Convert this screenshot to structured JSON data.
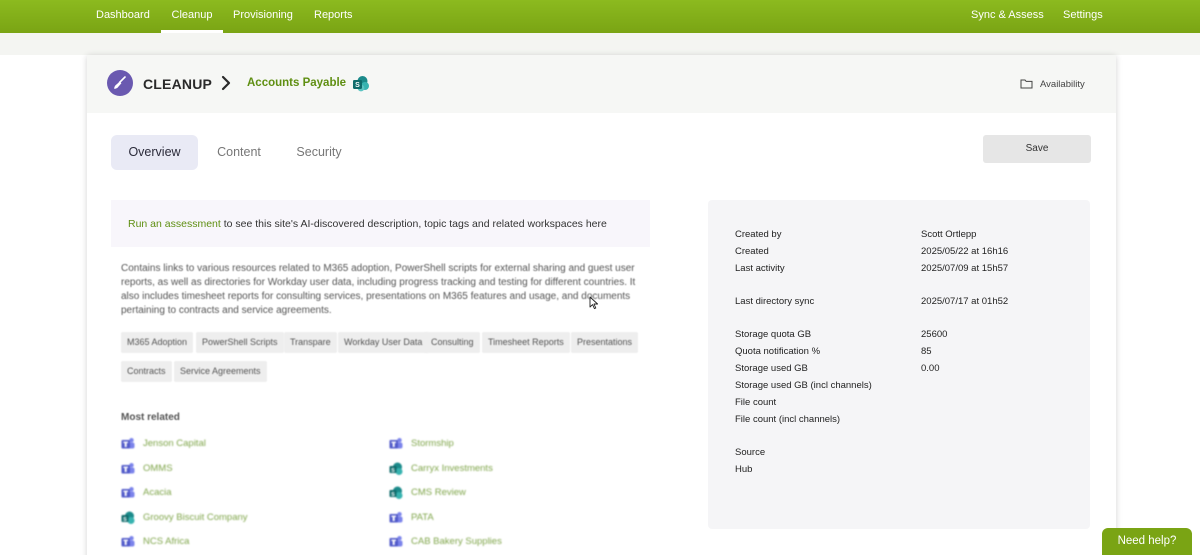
{
  "nav": {
    "items": [
      {
        "label": "Dashboard",
        "active": false
      },
      {
        "label": "Cleanup",
        "active": true
      },
      {
        "label": "Provisioning",
        "active": false
      },
      {
        "label": "Reports",
        "active": false
      }
    ],
    "right_items": [
      {
        "label": "Sync & Assess"
      },
      {
        "label": "Settings"
      }
    ]
  },
  "header": {
    "title": "CLEANUP",
    "site_name": "Accounts Payable",
    "availability_label": "Availability"
  },
  "tabs": [
    {
      "label": "Overview",
      "active": true
    },
    {
      "label": "Content",
      "active": false
    },
    {
      "label": "Security",
      "active": false
    }
  ],
  "save_label": "Save",
  "assessment": {
    "link_text": "Run an assessment",
    "rest_text": " to see this site's AI-discovered description, topic tags and related workspaces here"
  },
  "description": "Contains links to various resources related to M365 adoption, PowerShell scripts for external sharing and guest user reports, as well as directories for Workday user data, including progress tracking and testing for different countries. It also includes timesheet reports for consulting services, presentations on M365 features and usage, and documents pertaining to contracts and service agreements.",
  "tags": [
    "M365 Adoption",
    "PowerShell Scripts",
    "Transpare",
    "Workday User Data",
    "Consulting",
    "Timesheet Reports",
    "Presentations",
    "Contracts",
    "Service Agreements"
  ],
  "most_related": {
    "label": "Most related",
    "items": [
      {
        "label": "Jenson Capital",
        "icon": "teams-icon"
      },
      {
        "label": "Stormship",
        "icon": "teams-icon"
      },
      {
        "label": "OMMS",
        "icon": "teams-icon"
      },
      {
        "label": "Carryx Investments",
        "icon": "sharepoint-icon"
      },
      {
        "label": "Acacia",
        "icon": "teams-icon"
      },
      {
        "label": "CMS Review",
        "icon": "sharepoint-icon"
      },
      {
        "label": "Groovy Biscuit Company",
        "icon": "sharepoint-icon"
      },
      {
        "label": "PATA",
        "icon": "teams-icon"
      },
      {
        "label": "NCS Africa",
        "icon": "teams-icon"
      },
      {
        "label": "CAB Bakery Supplies",
        "icon": "teams-icon"
      }
    ]
  },
  "details": {
    "created_by": {
      "label": "Created by",
      "value": "Scott Ortlepp"
    },
    "created": {
      "label": "Created",
      "value": "2025/05/22 at 16h16"
    },
    "last_activity": {
      "label": "Last activity",
      "value": "2025/07/09 at 15h57"
    },
    "last_directory_sync": {
      "label": "Last directory sync",
      "value": "2025/07/17 at 01h52"
    },
    "storage_quota": {
      "label": "Storage quota GB",
      "value": "25600"
    },
    "quota_notification": {
      "label": "Quota notification %",
      "value": "85"
    },
    "storage_used": {
      "label": "Storage used GB",
      "value": "0.00"
    },
    "storage_used_channels": {
      "label": "Storage used GB (incl channels)",
      "value": ""
    },
    "file_count": {
      "label": "File count",
      "value": ""
    },
    "file_count_channels": {
      "label": "File count (incl channels)",
      "value": ""
    },
    "source": {
      "label": "Source",
      "value": ""
    },
    "hub": {
      "label": "Hub",
      "value": ""
    }
  },
  "help_label": "Need help?",
  "colors": {
    "brand_green": "#7aa414",
    "link_green": "#5f8f12",
    "accent_purple": "#6a59b0"
  }
}
